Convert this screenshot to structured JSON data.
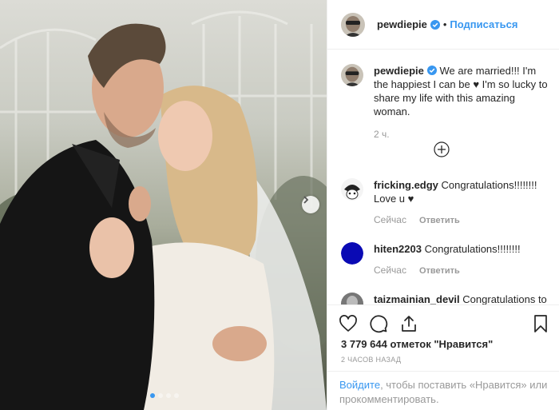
{
  "photo": {
    "next_icon": "chevron-right-icon",
    "carousel_count": 4,
    "carousel_active_index": 0
  },
  "header": {
    "username": "pewdiepie",
    "separator": "•",
    "follow_label": "Подписаться"
  },
  "caption": {
    "username": "pewdiepie",
    "text": "We are married!!! I'm the happiest I can be ♥ I'm so lucky to share my life with this amazing woman.",
    "time": "2 ч."
  },
  "load_more_icon": "plus-circle-icon",
  "comments": [
    {
      "username": "fricking.edgy",
      "text": "Congratulations!!!!!!!! Love u ♥",
      "time": "Сейчас",
      "reply_label": "Ответить"
    },
    {
      "username": "hiten2203",
      "text": "Congratulations!!!!!!!!",
      "time": "Сейчас",
      "reply_label": "Ответить"
    },
    {
      "username": "taizmainian_devil",
      "text": "Congratulations to"
    }
  ],
  "actions": {
    "like_icon": "heart-icon",
    "comment_icon": "comment-icon",
    "share_icon": "share-icon",
    "save_icon": "bookmark-icon"
  },
  "likes_text": "3 779 644 отметок \"Нравится\"",
  "timestamp": "2 часов назад",
  "login": {
    "link": "Войдите",
    "rest": ", чтобы поставить «Нравится» или прокомментировать."
  },
  "colors": {
    "accent": "#3897f0",
    "text": "#262626",
    "muted": "#999999",
    "border": "#efefef"
  }
}
